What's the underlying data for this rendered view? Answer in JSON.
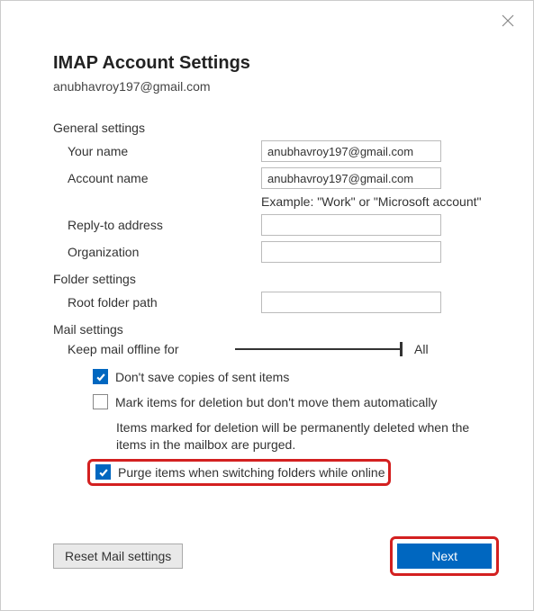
{
  "title": "IMAP Account Settings",
  "email": "anubhavroy197@gmail.com",
  "sections": {
    "general": "General settings",
    "folder": "Folder settings",
    "mail": "Mail settings"
  },
  "fields": {
    "your_name": {
      "label": "Your name",
      "value": "anubhavroy197@gmail.com"
    },
    "account_name": {
      "label": "Account name",
      "value": "anubhavroy197@gmail.com"
    },
    "reply_to": {
      "label": "Reply-to address",
      "value": ""
    },
    "organization": {
      "label": "Organization",
      "value": ""
    },
    "root_folder": {
      "label": "Root folder path",
      "value": ""
    }
  },
  "example_text": "Example: \"Work\" or \"Microsoft account\"",
  "slider": {
    "label": "Keep mail offline for",
    "value": "All"
  },
  "checkboxes": {
    "dont_save": "Don't save copies of sent items",
    "mark_deletion": "Mark items for deletion but don't move them automatically",
    "purge": "Purge items when switching folders while online"
  },
  "info": "Items marked for deletion will be permanently deleted when the items in the mailbox are purged.",
  "buttons": {
    "reset": "Reset Mail settings",
    "next": "Next"
  }
}
